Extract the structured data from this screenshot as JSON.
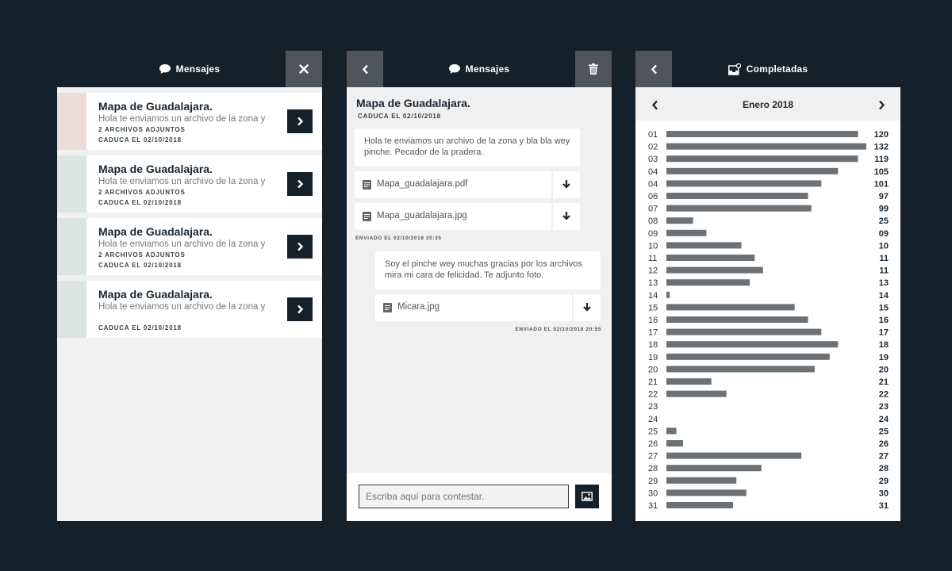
{
  "colors": {
    "dark": "#15212a",
    "header_button": "#4f555a",
    "bar": "#6b7174",
    "strip_red": "#ecdcdc",
    "strip_green": "#dce5e2"
  },
  "inbox": {
    "title": "Mensajes",
    "icons": {
      "title": "speech-bubble-icon",
      "close": "close-icon",
      "open": "chevron-right-icon"
    },
    "messages": [
      {
        "title": "Mapa de Guadalajara.",
        "preview": "Hola te enviamos un archivo de la zona y bla bla",
        "attachments": "2 ARCHIVOS ADJUNTOS",
        "expires": "CADUCA EL 02/10/2018",
        "status_color": "#ecdcdc"
      },
      {
        "title": "Mapa de Guadalajara.",
        "preview": "Hola te enviamos un archivo de la zona y bla bla",
        "attachments": "2 ARCHIVOS ADJUNTOS",
        "expires": "CADUCA EL 02/10/2018",
        "status_color": "#dce5e2"
      },
      {
        "title": "Mapa de Guadalajara.",
        "preview": "Hola te enviamos un archivo de la zona y bla bla",
        "attachments": "2 ARCHIVOS ADJUNTOS",
        "expires": "CADUCA EL 02/10/2018",
        "status_color": "#dce5e2"
      },
      {
        "title": "Mapa de Guadalajara.",
        "preview": "Hola te enviamos un archivo de la zona y bla bla",
        "attachments": "",
        "expires": "CADUCA EL 02/10/2018",
        "status_color": "#dce5e2"
      }
    ]
  },
  "chat": {
    "title": "Mensajes",
    "icons": {
      "back": "chevron-left-icon",
      "delete": "trash-icon",
      "file": "document-icon",
      "download": "download-arrow-icon",
      "image": "image-icon"
    },
    "subject": "Mapa de Guadalajara.",
    "expires": "CADUCA EL 02/10/2018",
    "incoming": {
      "text": "Hola te enviamos un archivo de la zona y bla bla wey pinche. Pecador de la pradera.",
      "files": [
        "Mapa_guadalajara.pdf",
        "Mapa_guadalajara.jpg"
      ],
      "sent": "ENVIADO EL 02/10/2018 20:35"
    },
    "outgoing": {
      "text": "Soy el pinche wey muchas gracias por los archivos mira mi cara de felicidad. Te adjunto foto.",
      "files": [
        "Micara.jpg"
      ],
      "sent": "ENVIADO EL 02/10/2018 20:55"
    },
    "reply_placeholder": "Escriba aquí para contestar."
  },
  "completed": {
    "title": "Completadas",
    "icons": {
      "title": "inbox-notification-icon",
      "back": "chevron-left-icon",
      "prev": "chevron-left-icon",
      "next": "chevron-right-icon"
    },
    "month": "Enero 2018"
  },
  "chart_data": {
    "type": "bar",
    "orientation": "horizontal",
    "categories": [
      "01",
      "02",
      "03",
      "04",
      "04",
      "06",
      "07",
      "08",
      "09",
      "10",
      "11",
      "12",
      "13",
      "14",
      "15",
      "16",
      "17",
      "18",
      "19",
      "20",
      "21",
      "22",
      "23",
      "24",
      "25",
      "26",
      "27",
      "28",
      "29",
      "30",
      "31"
    ],
    "value_labels": [
      "120",
      "132",
      "119",
      "105",
      "101",
      "97",
      "99",
      "25",
      "09",
      "10",
      "11",
      "11",
      "13",
      "14",
      "15",
      "16",
      "17",
      "18",
      "19",
      "20",
      "21",
      "22",
      "23",
      "24",
      "25",
      "26",
      "27",
      "28",
      "29",
      "30",
      "31"
    ],
    "values": [
      115,
      120,
      115,
      103,
      93,
      85,
      87,
      16,
      24,
      45,
      53,
      58,
      50,
      2,
      77,
      85,
      93,
      103,
      98,
      89,
      27,
      36,
      0,
      0,
      6,
      10,
      81,
      57,
      42,
      48,
      40
    ],
    "xlim": [
      0,
      120
    ],
    "grid": false
  }
}
